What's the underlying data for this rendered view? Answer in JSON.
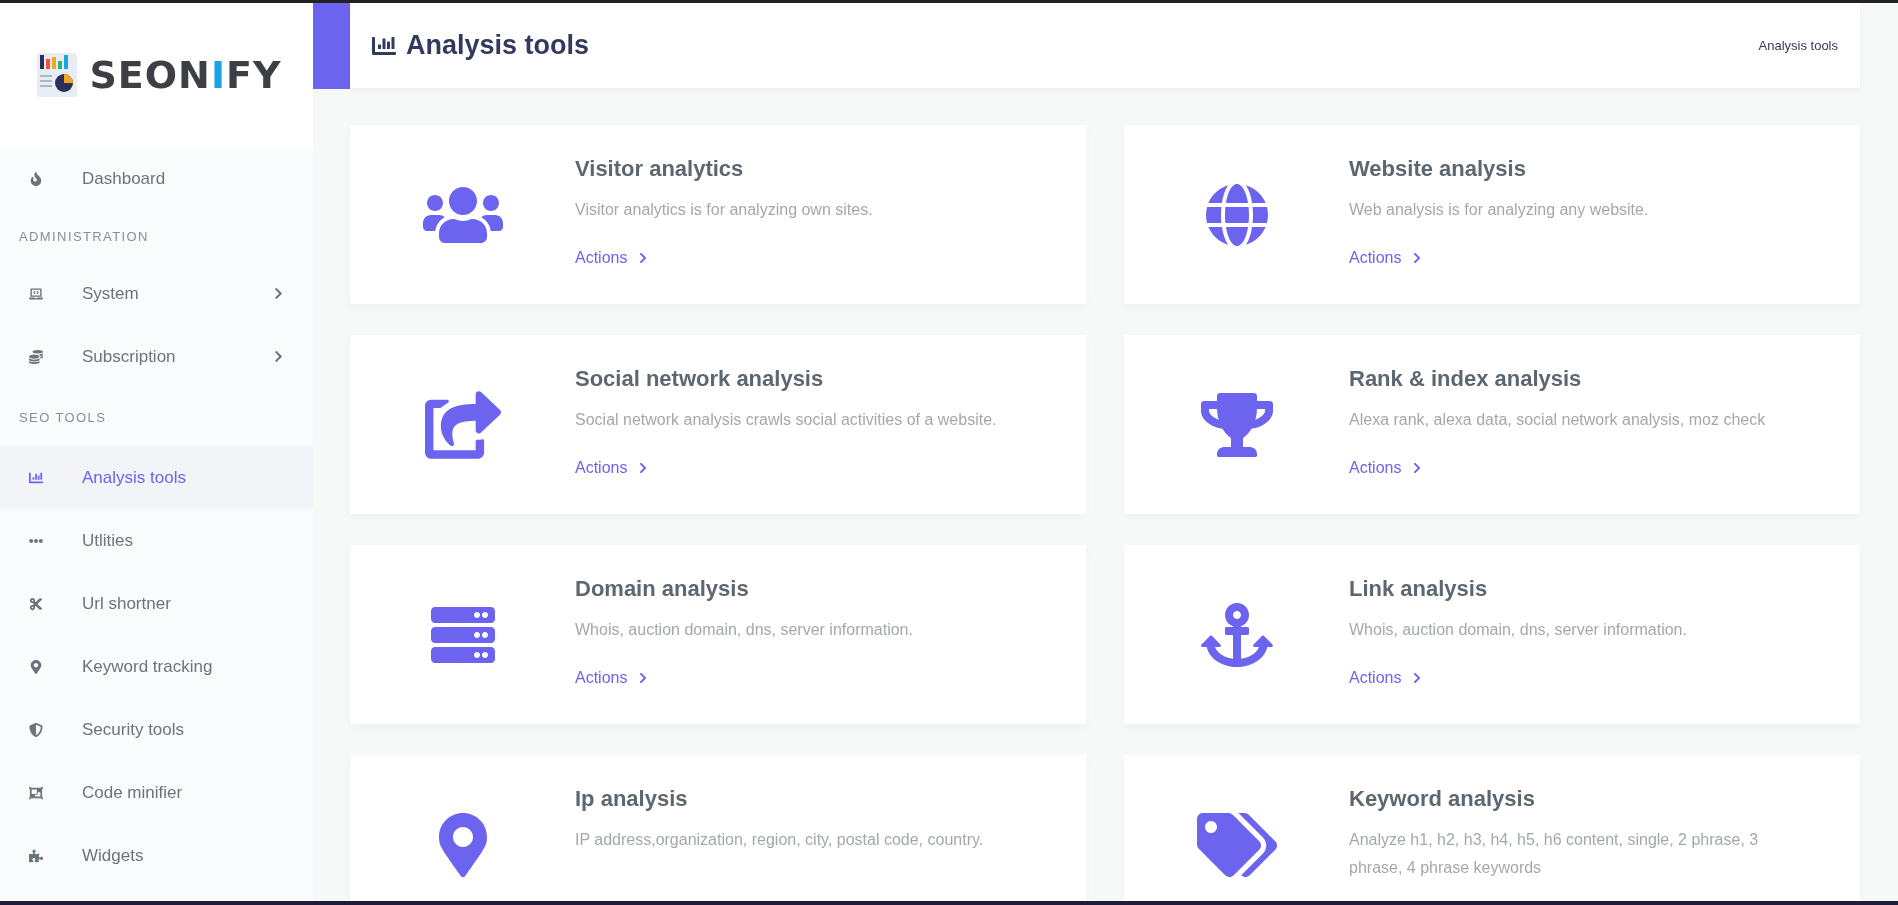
{
  "logo": {
    "text_before": "SEON",
    "highlight": "I",
    "text_after": "FY"
  },
  "nav": [
    {
      "kind": "link",
      "label": "Dashboard",
      "selected": false,
      "expandable": false
    },
    {
      "kind": "heading",
      "label": "ADMINISTRATION"
    },
    {
      "kind": "link",
      "label": "System",
      "selected": false,
      "expandable": true
    },
    {
      "kind": "link",
      "label": "Subscription",
      "selected": false,
      "expandable": true
    },
    {
      "kind": "heading",
      "label": "SEO TOOLS"
    },
    {
      "kind": "link",
      "label": "Analysis tools",
      "selected": true,
      "expandable": false
    },
    {
      "kind": "link",
      "label": "Utlities",
      "selected": false,
      "expandable": false
    },
    {
      "kind": "link",
      "label": "Url shortner",
      "selected": false,
      "expandable": false
    },
    {
      "kind": "link",
      "label": "Keyword tracking",
      "selected": false,
      "expandable": false
    },
    {
      "kind": "link",
      "label": "Security tools",
      "selected": false,
      "expandable": false
    },
    {
      "kind": "link",
      "label": "Code minifier",
      "selected": false,
      "expandable": false
    },
    {
      "kind": "link",
      "label": "Widgets",
      "selected": false,
      "expandable": false
    }
  ],
  "header": {
    "title": "Analysis tools",
    "breadcrumb": "Analysis tools"
  },
  "cards": [
    {
      "title": "Visitor analytics",
      "description": "Visitor analytics is for analyzing own sites.",
      "action": "Actions"
    },
    {
      "title": "Website analysis",
      "description": "Web analysis is for analyzing any website.",
      "action": "Actions"
    },
    {
      "title": "Social network analysis",
      "description": "Social network analysis crawls social activities of a website.",
      "action": "Actions"
    },
    {
      "title": "Rank & index analysis",
      "description": "Alexa rank, alexa data, social network analysis, moz check",
      "action": "Actions"
    },
    {
      "title": "Domain analysis",
      "description": "Whois, auction domain, dns, server information.",
      "action": "Actions"
    },
    {
      "title": "Link analysis",
      "description": "Whois, auction domain, dns, server information.",
      "action": "Actions"
    },
    {
      "title": "Ip analysis",
      "description": "IP address,organization, region, city, postal code, country."
    },
    {
      "title": "Keyword analysis",
      "description": "Analyze h1, h2, h3, h4, h5, h6 content, single, 2 phrase, 3 phrase, 4 phrase keywords"
    }
  ]
}
